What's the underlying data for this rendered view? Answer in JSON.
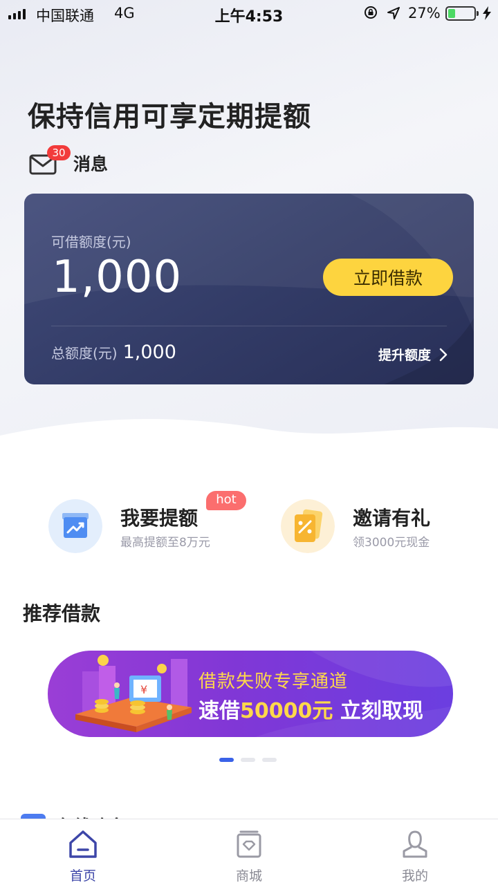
{
  "status_bar": {
    "carrier": "中国联通",
    "network": "4G",
    "time": "上午4:53",
    "battery_percent": "27%",
    "battery_level": 0.27
  },
  "headline": "保持信用可享定期提额",
  "messages": {
    "label": "消息",
    "count": "30"
  },
  "credit_card": {
    "available_label": "可借额度(元)",
    "available_amount": "1,000",
    "borrow_button": "立即借款",
    "total_label": "总额度(元)",
    "total_amount": "1,000",
    "raise_link": "提升额度"
  },
  "features": [
    {
      "title": "我要提额",
      "subtitle": "最高提额至8万元",
      "badge": "hot",
      "icon": "trend-up-icon"
    },
    {
      "title": "邀请有礼",
      "subtitle": "领3000元现金",
      "icon": "coupon-icon"
    }
  ],
  "recommend": {
    "title": "推荐借款",
    "banner": {
      "line1": "借款失败专享通道",
      "line2_prefix": "速借",
      "line2_amount": "50000元",
      "line2_suffix": "立刻取现"
    },
    "dots_total": 3,
    "dots_active": 0
  },
  "next_section_label": "在线购务",
  "tabs": [
    {
      "label": "首页",
      "icon": "home-icon",
      "active": true
    },
    {
      "label": "商城",
      "icon": "shop-icon",
      "active": false
    },
    {
      "label": "我的",
      "icon": "profile-icon",
      "active": false
    }
  ],
  "colors": {
    "accent": "#3d46a8",
    "button_yellow": "#fdd43f",
    "badge_red": "#f23b3b",
    "card_bg": "#323b66",
    "banner_purple": "#8137d6"
  }
}
